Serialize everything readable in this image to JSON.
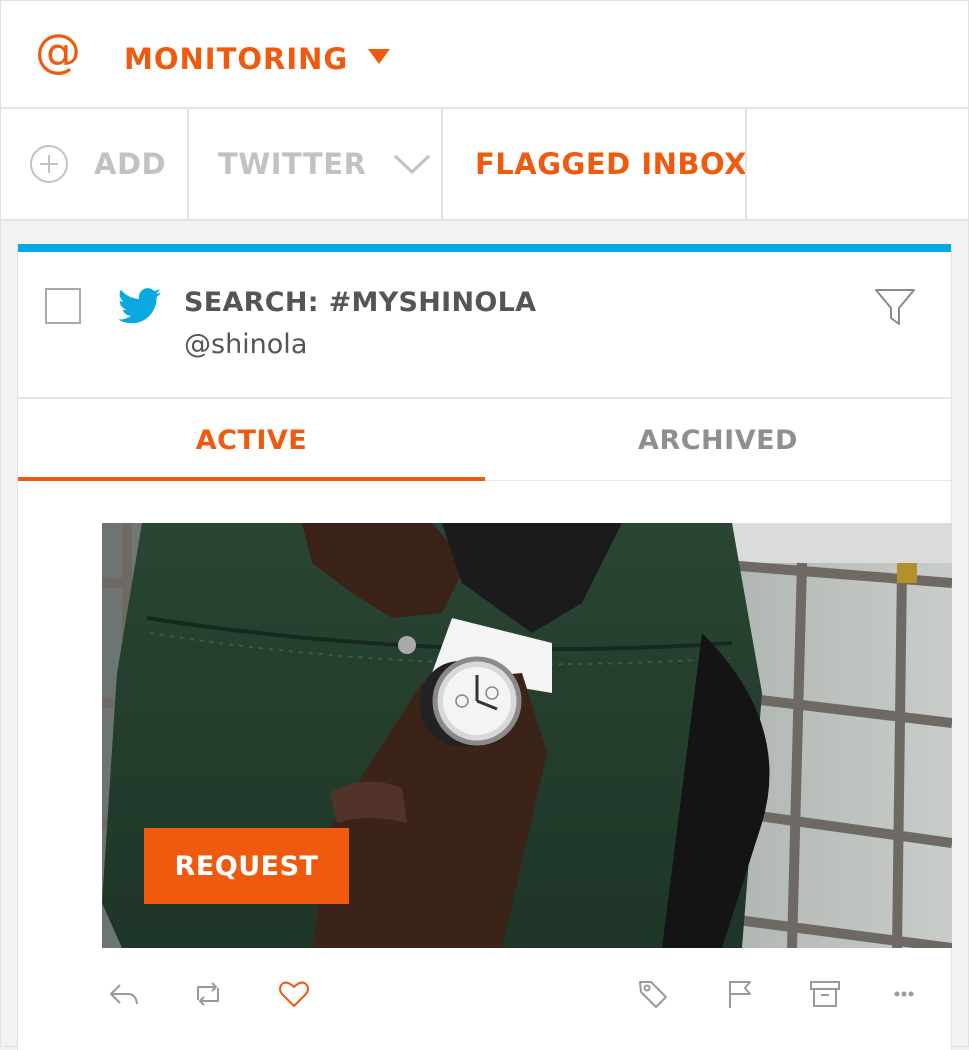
{
  "header": {
    "at_symbol": "@",
    "title": "MONITORING"
  },
  "toolbar": {
    "add_label": "ADD",
    "twitter_label": "TWITTER",
    "flagged_label": "FLAGGED INBOX"
  },
  "stream": {
    "title": "SEARCH: #MYSHINOLA",
    "handle": "@shinola"
  },
  "tabs": {
    "active": "ACTIVE",
    "archived": "ARCHIVED"
  },
  "post": {
    "request_label": "REQUEST"
  },
  "colors": {
    "accent": "#f05a0f",
    "twitter_blue": "#08a9e1",
    "muted": "#c2c2c2",
    "text": "#555555"
  },
  "icons": [
    "at-icon",
    "caret-down-icon",
    "add-circle-icon",
    "chevron-down-icon",
    "twitter-bird-icon",
    "filter-icon",
    "reply-icon",
    "retweet-icon",
    "heart-icon",
    "tag-icon",
    "flag-icon",
    "archive-icon",
    "more-icon"
  ]
}
